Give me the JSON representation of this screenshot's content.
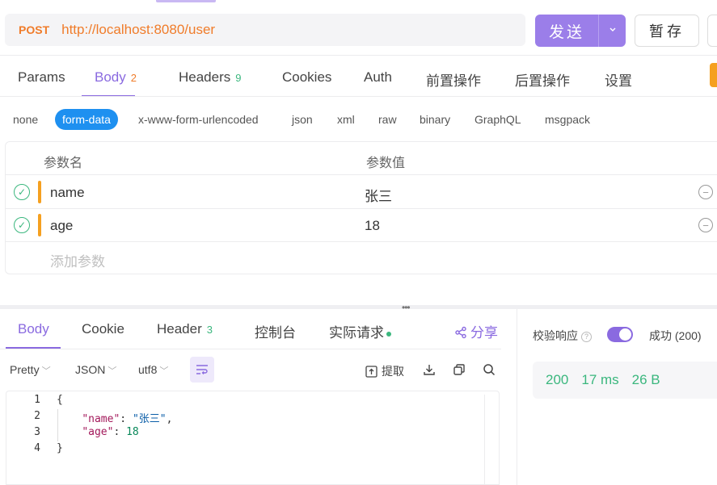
{
  "request": {
    "method": "POST",
    "url": "http://localhost:8080/user",
    "send_label": "发送",
    "save_label": "暂存"
  },
  "req_tabs": [
    {
      "label": "Params"
    },
    {
      "label": "Body",
      "badge": "2"
    },
    {
      "label": "Headers",
      "badge": "9"
    },
    {
      "label": "Cookies"
    },
    {
      "label": "Auth"
    },
    {
      "label": "前置操作"
    },
    {
      "label": "后置操作"
    },
    {
      "label": "设置"
    }
  ],
  "body_types": [
    "none",
    "form-data",
    "x-www-form-urlencoded",
    "json",
    "xml",
    "raw",
    "binary",
    "GraphQL",
    "msgpack"
  ],
  "params": {
    "header_name": "参数名",
    "header_value": "参数值",
    "rows": [
      {
        "name": "name",
        "value": "张三"
      },
      {
        "name": "age",
        "value": "18"
      }
    ],
    "add_placeholder": "添加参数"
  },
  "response": {
    "tabs": [
      {
        "label": "Body"
      },
      {
        "label": "Cookie"
      },
      {
        "label": "Header",
        "badge": "3"
      },
      {
        "label": "控制台"
      },
      {
        "label": "实际请求"
      }
    ],
    "share_label": "分享",
    "toolbar": {
      "format": "Pretty",
      "type": "JSON",
      "encoding": "utf8",
      "extract_label": "提取"
    },
    "code": {
      "line_numbers": [
        "1",
        "2",
        "3",
        "4"
      ],
      "open_brace": "{",
      "close_brace": "}",
      "key1": "\"name\"",
      "val1": "\"张三\"",
      "key2": "\"age\"",
      "val2": "18"
    },
    "verify_label": "校验响应",
    "success_label": "成功 (200)",
    "status": "200",
    "time": "17 ms",
    "size": "26 B"
  },
  "colors": {
    "accent": "#8a6ae0",
    "method": "#f07c2a",
    "success": "#3bb77e",
    "form_data": "#1e90f0"
  }
}
